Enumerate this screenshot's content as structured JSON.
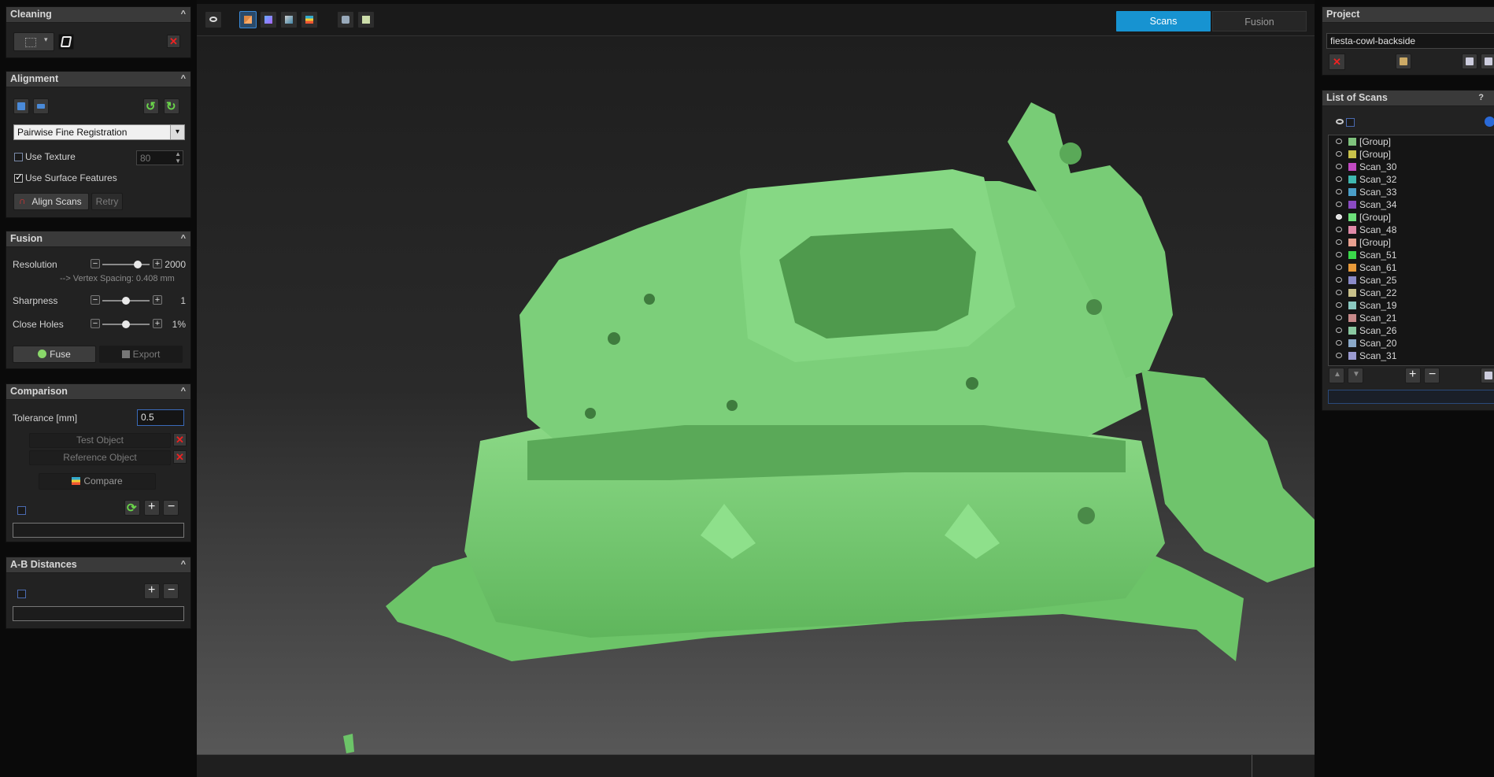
{
  "cleaning": {
    "title": "Cleaning",
    "collapse": "^"
  },
  "alignment": {
    "title": "Alignment",
    "collapse": "^",
    "method": "Pairwise Fine Registration",
    "use_texture_label": "Use Texture",
    "texture_value": "80",
    "use_surface_label": "Use Surface Features",
    "use_surface_checked": true,
    "align_label": "Align Scans",
    "retry_label": "Retry"
  },
  "fusion": {
    "title": "Fusion",
    "collapse": "^",
    "resolution_label": "Resolution",
    "resolution_value": "2000",
    "resolution_level": 0.75,
    "vertex_spacing": "--> Vertex Spacing: 0.408 mm",
    "sharpness_label": "Sharpness",
    "sharpness_value": "1",
    "sharpness_level": 0.5,
    "holes_label": "Close Holes",
    "holes_value": "1%",
    "holes_level": 0.5,
    "fuse_label": "Fuse",
    "export_label": "Export"
  },
  "comparison": {
    "title": "Comparison",
    "collapse": "^",
    "tolerance_label": "Tolerance [mm]",
    "tolerance_value": "0.5",
    "test_label": "Test Object",
    "reference_label": "Reference Object",
    "compare_label": "Compare"
  },
  "ab": {
    "title": "A-B Distances",
    "collapse": "^"
  },
  "viewport": {
    "tab_scans": "Scans",
    "tab_fusion": "Fusion",
    "accent": "#1793d1",
    "mesh_color": "#7ccf7a"
  },
  "project": {
    "title": "Project",
    "name": "fiesta-cowl-backside"
  },
  "scans": {
    "title": "List of Scans",
    "help": "?",
    "items": [
      {
        "name": "[Group]",
        "color": "#7fc27d",
        "visible": false
      },
      {
        "name": "[Group]",
        "color": "#c8c24a",
        "visible": false
      },
      {
        "name": "Scan_30",
        "color": "#c24ac2",
        "visible": false
      },
      {
        "name": "Scan_32",
        "color": "#3fb8b0",
        "visible": false
      },
      {
        "name": "Scan_33",
        "color": "#4a9ec8",
        "visible": false
      },
      {
        "name": "Scan_34",
        "color": "#8a4ac2",
        "visible": false
      },
      {
        "name": "[Group]",
        "color": "#6de07a",
        "visible": true
      },
      {
        "name": "Scan_48",
        "color": "#e08aa8",
        "visible": false
      },
      {
        "name": "[Group]",
        "color": "#e8a090",
        "visible": false
      },
      {
        "name": "Scan_51",
        "color": "#3ad84a",
        "visible": false
      },
      {
        "name": "Scan_61",
        "color": "#e89a3a",
        "visible": false
      },
      {
        "name": "Scan_25",
        "color": "#8a8ac8",
        "visible": false
      },
      {
        "name": "Scan_22",
        "color": "#c8c08a",
        "visible": false
      },
      {
        "name": "Scan_19",
        "color": "#8ac8c0",
        "visible": false
      },
      {
        "name": "Scan_21",
        "color": "#c88a8a",
        "visible": false
      },
      {
        "name": "Scan_26",
        "color": "#8ac8a0",
        "visible": false
      },
      {
        "name": "Scan_20",
        "color": "#8aa8c8",
        "visible": false
      },
      {
        "name": "Scan_31",
        "color": "#9a9ad0",
        "visible": false
      }
    ]
  }
}
